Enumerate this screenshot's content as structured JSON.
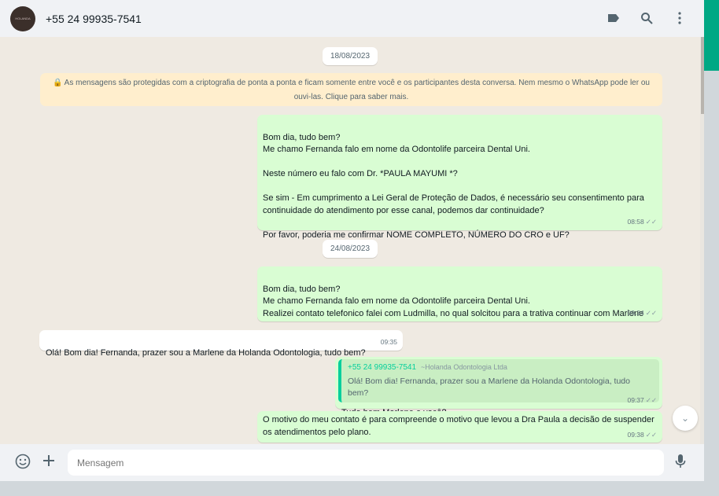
{
  "header": {
    "contact": "+55 24 99935-7541",
    "avatar_text": "HOLANDA"
  },
  "dates": [
    "18/08/2023",
    "24/08/2023"
  ],
  "notice": "🔒 As mensagens são protegidas com a criptografia de ponta a ponta e ficam somente entre você e os participantes desta conversa. Nem mesmo o WhatsApp pode ler ou ouvi-las. Clique para saber mais.",
  "messages": [
    {
      "text": "Bom dia, tudo bem?\nMe chamo Fernanda falo em nome da Odontolife parceira Dental Uni.\n\nNeste número eu falo com Dr. *PAULA MAYUMI *?\n\nSe sim - Em cumprimento a Lei Geral de Proteção de Dados, é necessário seu consentimento para continuidade do atendimento por esse canal, podemos dar continuidade?\n\nPor favor, poderia me confirmar NOME COMPLETO, NÚMERO DO CRO e UF?",
      "time": "08:58"
    },
    {
      "text": "Bom dia, tudo bem?\nMe chamo Fernanda falo em nome da Odontolife parceira Dental Uni.\nRealizei contato telefonico falei com Ludmilla, no qual solcitou para a trativa continuar com Marlene",
      "time": "09:34"
    },
    {
      "text": "Olá! Bom dia! Fernanda, prazer sou a  Marlene da Holanda Odontologia, tudo bem?",
      "time": "09:35"
    },
    {
      "quote_name": "+55 24 99935-7541",
      "quote_sub": "~Holanda Odontologia Ltda",
      "quote_text": "Olá! Bom dia! Fernanda, prazer sou a  Marlene da Holanda Odontologia, tudo bem?",
      "text": "Tudo bem Marlene e você?",
      "time": "09:37"
    },
    {
      "text": "O motivo do meu contato é para compreende o motivo que levou a Dra Paula a decisão de suspender os atendimentos pelo plano.",
      "time": "09:38"
    }
  ],
  "footer": {
    "placeholder": "Mensagem"
  }
}
